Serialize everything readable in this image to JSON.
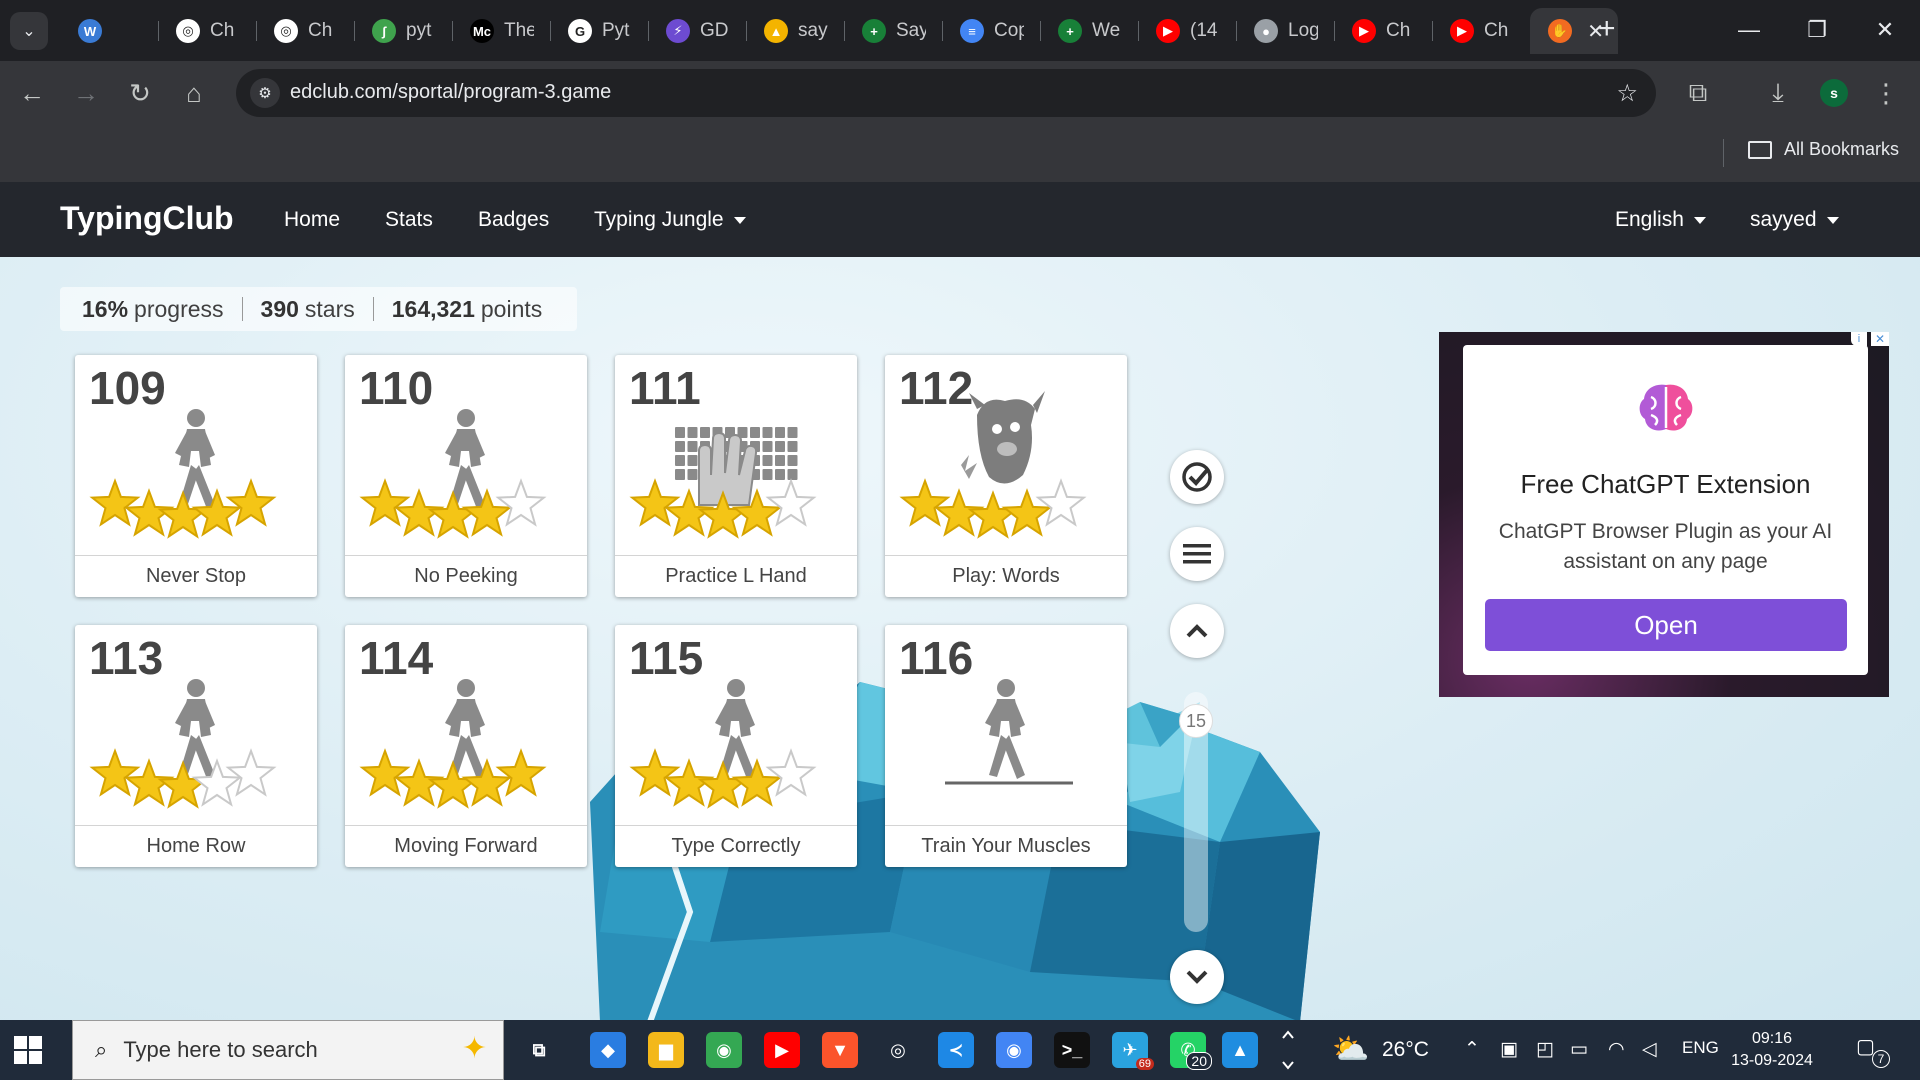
{
  "browser": {
    "tabs": [
      {
        "title": "Ch",
        "icon": "openai-icon",
        "color": "#ffffff",
        "glyph": "◎"
      },
      {
        "title": "Ch",
        "icon": "openai-icon",
        "color": "#ffffff",
        "glyph": "◎"
      },
      {
        "title": "pyt",
        "icon": "leaf-icon",
        "color": "#3fa34d",
        "glyph": "ʃ"
      },
      {
        "title": "The",
        "icon": "medium-icon",
        "color": "#000000",
        "glyph": "Mc"
      },
      {
        "title": "Pyt",
        "icon": "google-icon",
        "color": "#ffffff",
        "glyph": "G"
      },
      {
        "title": "GD",
        "icon": "gdscript-icon",
        "color": "#6d4bd1",
        "glyph": "⚡"
      },
      {
        "title": "say",
        "icon": "drive-icon",
        "color": "#f4b400",
        "glyph": "▲"
      },
      {
        "title": "Say",
        "icon": "sheets-icon",
        "color": "#188038",
        "glyph": "+"
      },
      {
        "title": "Cop",
        "icon": "docs-icon",
        "color": "#4285f4",
        "glyph": "≡"
      },
      {
        "title": "We",
        "icon": "sheets-icon",
        "color": "#188038",
        "glyph": "+"
      },
      {
        "title": "(14",
        "icon": "youtube-icon",
        "color": "#ff0000",
        "glyph": "▶"
      },
      {
        "title": "Log",
        "icon": "github-icon",
        "color": "#9aa0a6",
        "glyph": "●"
      },
      {
        "title": "Ch",
        "icon": "youtube-icon",
        "color": "#ff0000",
        "glyph": "▶"
      },
      {
        "title": "Ch",
        "icon": "youtube-icon",
        "color": "#ff0000",
        "glyph": "▶"
      }
    ],
    "active_tab": {
      "icon": "typingclub-icon",
      "color": "#f26b21",
      "glyph": "✋"
    },
    "url": "edclub.com/sportal/program-3.game",
    "profile_initial": "s",
    "all_bookmarks": "All Bookmarks"
  },
  "nav": {
    "brand": "TypingClub",
    "home": "Home",
    "stats": "Stats",
    "badges": "Badges",
    "jungle": "Typing Jungle",
    "language": "English",
    "user": "sayyed"
  },
  "progress": {
    "percent": "16%",
    "percent_label": "progress",
    "stars": "390",
    "stars_label": "stars",
    "points": "164,321",
    "points_label": "points"
  },
  "lessons": [
    {
      "num": "109",
      "name": "Never Stop",
      "art": "walker",
      "stars": 5
    },
    {
      "num": "110",
      "name": "No Peeking",
      "art": "walker",
      "stars": 4
    },
    {
      "num": "111",
      "name": "Practice L Hand",
      "art": "keyboard",
      "stars": 4
    },
    {
      "num": "112",
      "name": "Play: Words",
      "art": "monster",
      "stars": 4
    },
    {
      "num": "113",
      "name": "Home Row",
      "art": "walker",
      "stars": 3
    },
    {
      "num": "114",
      "name": "Moving Forward",
      "art": "walker",
      "stars": 5
    },
    {
      "num": "115",
      "name": "Type Correctly",
      "art": "walker",
      "stars": 4
    },
    {
      "num": "116",
      "name": "Train Your Muscles",
      "art": "walker-plain",
      "stars": 0
    }
  ],
  "side": {
    "scroll_number": "15"
  },
  "ad": {
    "title": "Free ChatGPT Extension",
    "description": "ChatGPT Browser Plugin as your AI assistant on any page",
    "button": "Open"
  },
  "taskbar": {
    "search_placeholder": "Type here to search",
    "apps": [
      {
        "name": "task-view-icon",
        "glyph": "⧉",
        "bg": "transparent"
      },
      {
        "name": "copilot-icon",
        "glyph": "◆",
        "bg": "#2a7de1"
      },
      {
        "name": "file-explorer-icon",
        "glyph": "▆",
        "bg": "#f3b81a"
      },
      {
        "name": "chrome-icon",
        "glyph": "◉",
        "bg": "#34a853"
      },
      {
        "name": "youtube-app-icon",
        "glyph": "▶",
        "bg": "#ff0000"
      },
      {
        "name": "brave-icon",
        "glyph": "▼",
        "bg": "#fb542b"
      },
      {
        "name": "chatgpt-app-icon",
        "glyph": "◎",
        "bg": "transparent"
      },
      {
        "name": "vscode-icon",
        "glyph": "≺",
        "bg": "#1e88e5"
      },
      {
        "name": "chrome-profile-icon",
        "glyph": "◉",
        "bg": "#4285f4"
      },
      {
        "name": "terminal-icon",
        "glyph": ">_",
        "bg": "#111111"
      },
      {
        "name": "telegram-icon",
        "glyph": "✈",
        "bg": "#2aa3df",
        "badge": "69"
      },
      {
        "name": "whatsapp-icon",
        "glyph": "✆",
        "bg": "#25d366",
        "badge": "20"
      },
      {
        "name": "photos-icon",
        "glyph": "▲",
        "bg": "#1f8de0"
      }
    ],
    "temperature": "26°C",
    "language": "ENG",
    "time": "09:16",
    "date": "13-09-2024",
    "notifications": "7"
  }
}
